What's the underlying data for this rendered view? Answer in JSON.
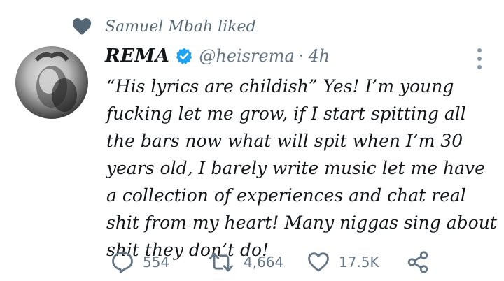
{
  "social_context": {
    "text": "Samuel Mbah liked",
    "icon": "heart-icon"
  },
  "tweet": {
    "display_name": "REMA",
    "verified": true,
    "handle": "@heisrema",
    "separator": "·",
    "time": "4h",
    "text": "“His lyrics are childish” Yes! I’m young fucking let me grow, if I start spitting all the bars now what will spit when I’m 30 years old, I barely write music let me have a collection of experiences and chat real shit from my heart! Many niggas sing about shit they don’t do!"
  },
  "actions": {
    "reply_count": "554",
    "retweet_count": "4,664",
    "like_count": "17.5K"
  },
  "colors": {
    "text": "#14171a",
    "secondary": "#657786",
    "verified": "#1da1f2"
  }
}
